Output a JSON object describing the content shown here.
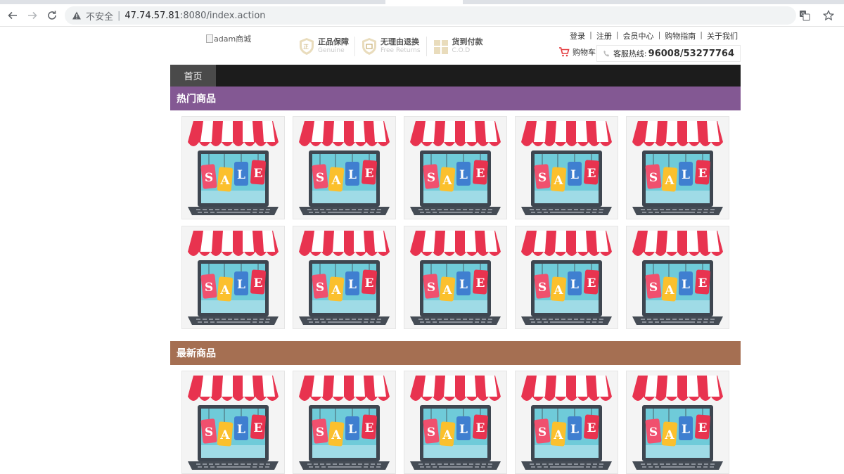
{
  "browser": {
    "security_label": "不安全",
    "url_host": "47.74.57.81",
    "url_path": ":8080/index.action"
  },
  "header": {
    "logo_alt": "adam商城",
    "guarantees": [
      {
        "cn": "正品保障",
        "en": "Genuine"
      },
      {
        "cn": "无理由退换",
        "en": "Free Returns"
      },
      {
        "cn": "货到付款",
        "en": "C.O.D"
      }
    ],
    "top_links": [
      "登录",
      "注册",
      "会员中心",
      "购物指南",
      "关于我们"
    ],
    "cart_label": "购物车",
    "hotline_label": "客服热线:",
    "hotline_number": "96008/53277764"
  },
  "nav": {
    "home": "首页"
  },
  "sections": {
    "hot_title": "热门商品",
    "new_title": "最新商品"
  },
  "product_image": {
    "letters": [
      "S",
      "A",
      "L",
      "E"
    ]
  },
  "colors": {
    "nav_bg": "#1c1c1c",
    "nav_active": "#4a4a4a",
    "hot_bar": "#835893",
    "new_bar": "#a56f52"
  }
}
